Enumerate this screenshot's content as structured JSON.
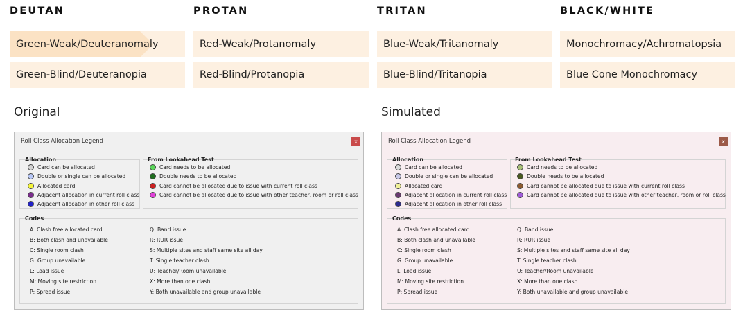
{
  "categories": [
    {
      "title": "DEUTAN",
      "options": [
        "Green-Weak/Deuteranomaly",
        "Green-Blind/Deuteranopia"
      ]
    },
    {
      "title": "PROTAN",
      "options": [
        "Red-Weak/Protanomaly",
        "Red-Blind/Protanopia"
      ]
    },
    {
      "title": "TRITAN",
      "options": [
        "Blue-Weak/Tritanomaly",
        "Blue-Blind/Tritanopia"
      ]
    },
    {
      "title": "BLACK/WHITE",
      "options": [
        "Monochromacy/Achromatopsia",
        "Blue Cone Monochromacy"
      ]
    }
  ],
  "selected_option": "Green-Weak/Deuteranomaly",
  "panels": {
    "original_label": "Original",
    "simulated_label": "Simulated"
  },
  "legend_window": {
    "title": "Roll Class Allocation Legend",
    "close_glyph": "x",
    "allocation_title": "Allocation",
    "allocation_items": [
      "Card can be allocated",
      "Double or single can be allocated",
      "Allocated card",
      "Adjacent allocation in current roll class",
      "Adjacent allocation in other roll class"
    ],
    "lookahead_title": "From Lookahead Test",
    "lookahead_items": [
      "Card needs to be allocated",
      "Double needs to be allocated",
      "Card cannot be allocated due to issue with current roll class",
      "Card cannot be allocated due to issue with other teacher, room or roll class"
    ],
    "codes_title": "Codes",
    "codes_left": [
      "A: Clash free allocated card",
      "B: Both clash and unavailable",
      "C: Single room clash",
      "G: Group unavailable",
      "L: Load issue",
      "M: Moving site restriction",
      "P: Spread issue"
    ],
    "codes_right": [
      "Q: Band issue",
      "R: RUR issue",
      "S: Multiple sites and staff same site all day",
      "T: Single teacher clash",
      "U: Teacher/Room unavailable",
      "X: More than one clash",
      "Y: Both unavailable and group unavailable"
    ]
  },
  "colors": {
    "original": {
      "window_bg": "#f0f0f0",
      "close_bg": "#c94b4b",
      "allocation_dots": [
        "#d4d4d4",
        "#b8c8f8",
        "#f5f53a",
        "#7a2c8c",
        "#2222c8"
      ],
      "lookahead_dots": [
        "#5ad65a",
        "#1e6e1e",
        "#cc2020",
        "#e040d8"
      ]
    },
    "simulated": {
      "window_bg": "#f8edf0",
      "close_bg": "#9c5a48",
      "allocation_dots": [
        "#dadada",
        "#c8c8e8",
        "#f0f098",
        "#6a3a70",
        "#2c2c8c"
      ],
      "lookahead_dots": [
        "#a8c078",
        "#4a5a20",
        "#8c5a30",
        "#a05ad8"
      ]
    }
  }
}
